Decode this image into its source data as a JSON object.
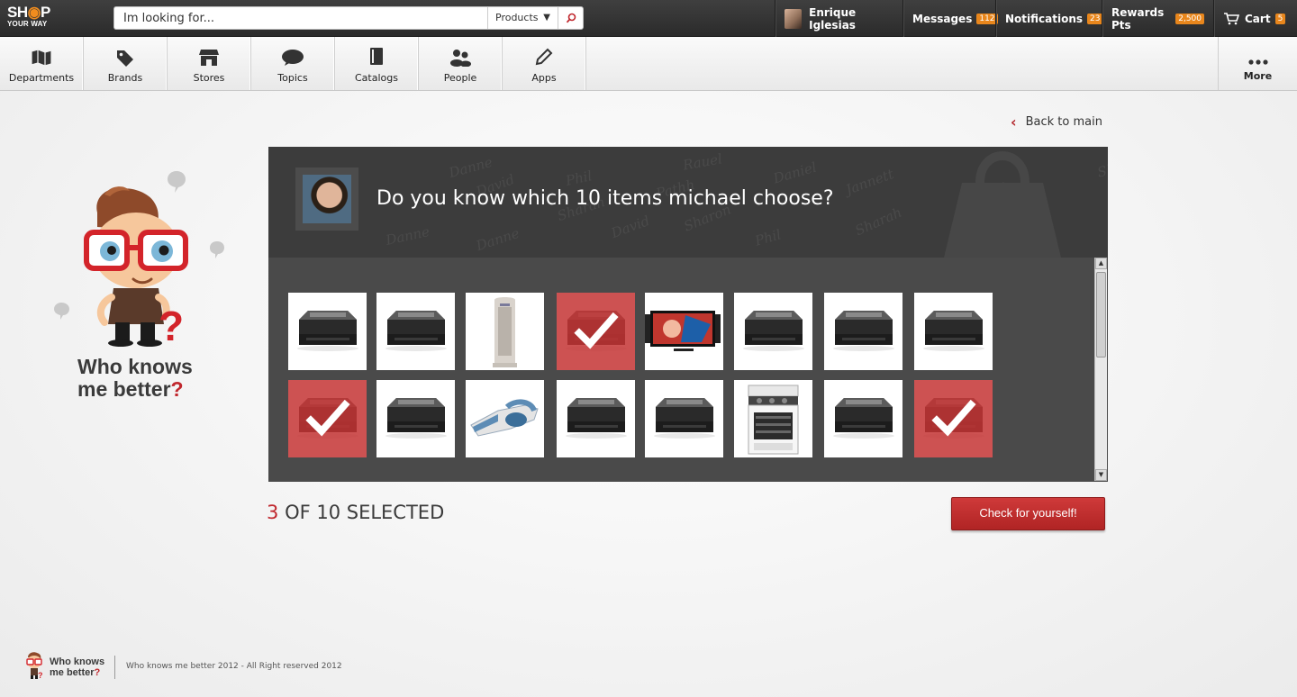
{
  "header": {
    "logo_line1_a": "SH",
    "logo_line1_b": "P",
    "logo_line2": "YOUR WAY",
    "search": {
      "placeholder": "Im looking for...",
      "category": "Products"
    },
    "user_name": "Enrique Iglesias",
    "messages": {
      "label": "Messages",
      "count": "112"
    },
    "notifications": {
      "label": "Notifications",
      "count": "23"
    },
    "rewards": {
      "label": "Rewards Pts",
      "count": "2,500"
    },
    "cart": {
      "label": "Cart",
      "count": "5"
    }
  },
  "nav": {
    "items": [
      {
        "label": "Departments",
        "icon": "map-icon"
      },
      {
        "label": "Brands",
        "icon": "tag-icon"
      },
      {
        "label": "Stores",
        "icon": "store-icon"
      },
      {
        "label": "Topics",
        "icon": "speech-bubble-icon"
      },
      {
        "label": "Catalogs",
        "icon": "catalog-icon"
      },
      {
        "label": "People",
        "icon": "people-icon"
      },
      {
        "label": "Apps",
        "icon": "pencil-icon"
      }
    ],
    "more_label": "More"
  },
  "brand": {
    "line1": "Who knows",
    "line2": "me better",
    "q": "?"
  },
  "back_link": "Back to main",
  "quiz": {
    "question": "Do you know which 10 items michael choose?",
    "watermark_names": [
      "Danne",
      "David",
      "Phil",
      "Sharah",
      "Pathh",
      "Sharon",
      "Rauel",
      "Daniel",
      "Jannett",
      "Sharah",
      "Pathh",
      "David",
      "Danne"
    ],
    "items": [
      {
        "product": "printer",
        "selected": false
      },
      {
        "product": "printer",
        "selected": false
      },
      {
        "product": "air-purifier",
        "selected": false
      },
      {
        "product": "printer",
        "selected": true
      },
      {
        "product": "tv",
        "selected": false
      },
      {
        "product": "printer",
        "selected": false
      },
      {
        "product": "printer",
        "selected": false
      },
      {
        "product": "printer",
        "selected": false
      },
      {
        "product": "printer",
        "selected": true
      },
      {
        "product": "printer",
        "selected": false
      },
      {
        "product": "handheld-vacuum",
        "selected": false
      },
      {
        "product": "printer",
        "selected": false
      },
      {
        "product": "printer",
        "selected": false
      },
      {
        "product": "stove",
        "selected": false
      },
      {
        "product": "printer",
        "selected": false
      },
      {
        "product": "printer",
        "selected": true
      }
    ],
    "selected_count": "3",
    "selected_suffix": "OF 10 SELECTED",
    "cta": "Check for yourself!"
  },
  "footer": {
    "brand_line1": "Who knows",
    "brand_line2": "me better",
    "brand_q": "?",
    "copyright": "Who knows me better 2012 - All Right reserved 2012"
  },
  "colors": {
    "accent_red": "#c0272d",
    "badge_orange": "#e8861c",
    "panel_dark": "#3c3c3c"
  }
}
